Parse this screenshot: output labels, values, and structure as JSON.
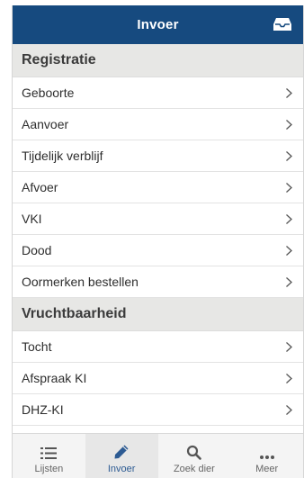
{
  "header": {
    "title": "Invoer",
    "inbox_icon": "inbox-icon"
  },
  "sections": [
    {
      "title": "Registratie",
      "items": [
        {
          "label": "Geboorte"
        },
        {
          "label": "Aanvoer"
        },
        {
          "label": "Tijdelijk verblijf"
        },
        {
          "label": "Afvoer"
        },
        {
          "label": "VKI"
        },
        {
          "label": "Dood"
        },
        {
          "label": "Oormerken bestellen"
        }
      ]
    },
    {
      "title": "Vruchtbaarheid",
      "items": [
        {
          "label": "Tocht"
        },
        {
          "label": "Afspraak KI"
        },
        {
          "label": "DHZ-KI"
        }
      ]
    }
  ],
  "tabbar": {
    "tabs": [
      {
        "label": "Lijsten",
        "icon": "list-icon",
        "active": false
      },
      {
        "label": "Invoer",
        "icon": "pencil-icon",
        "active": true
      },
      {
        "label": "Zoek dier",
        "icon": "search-icon",
        "active": false
      },
      {
        "label": "Meer",
        "icon": "more-icon",
        "active": false
      }
    ]
  },
  "colors": {
    "header_bg": "#164a7f",
    "section_bg": "#e7e7e5",
    "active_tab": "#2d5b93"
  }
}
